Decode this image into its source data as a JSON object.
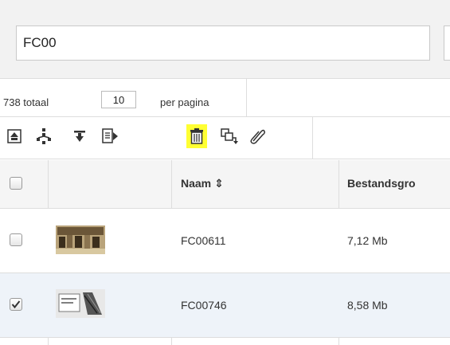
{
  "search": {
    "value": "FC00"
  },
  "pager": {
    "total_text": "738 totaal",
    "per_page_value": "10",
    "per_page_label": "per pagina"
  },
  "toolbar": {
    "icons": [
      "move-top-icon",
      "split-icon",
      "move-bottom-icon",
      "export-icon",
      "trash-icon",
      "copy-icon",
      "attach-icon"
    ],
    "highlight_color": "#ffff33"
  },
  "table": {
    "columns": [
      "Naam ⇕",
      "Bestandsgro"
    ],
    "rows": [
      {
        "name": "FC00611",
        "size": "7,12 Mb",
        "checked": false
      },
      {
        "name": "FC00746",
        "size": "8,58 Mb",
        "checked": true
      }
    ]
  },
  "colors": {
    "panel_bg": "#f2f2f2",
    "row_alt_bg": "#eef3f9",
    "border": "#dddddd"
  }
}
